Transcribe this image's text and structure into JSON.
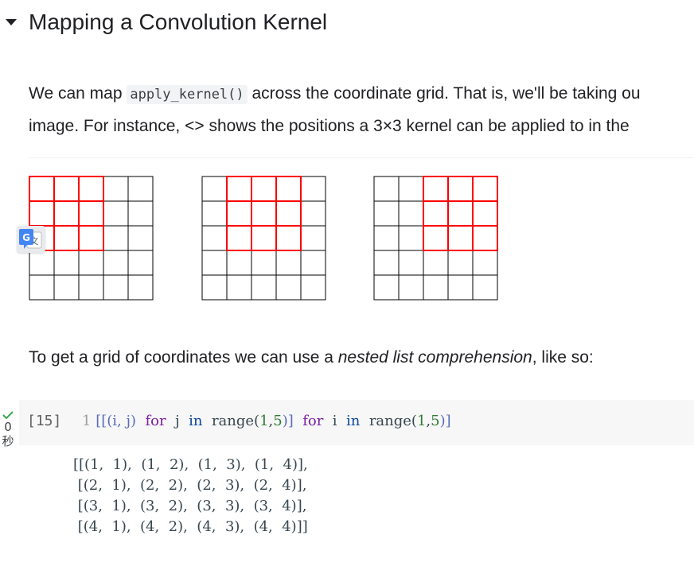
{
  "section": {
    "title": "Mapping a Convolution Kernel"
  },
  "intro": {
    "line1_before": "We can map ",
    "line1_code": "apply_kernel()",
    "line1_after": " across the coordinate grid. That is, we'll be taking ou",
    "line2": "image. For instance, <> shows the positions a 3×3 kernel can be applied to in the"
  },
  "figures": [
    {
      "grid_size": 5,
      "kernel_size": 3,
      "kernel_row": 0,
      "kernel_col": 0
    },
    {
      "grid_size": 5,
      "kernel_size": 3,
      "kernel_row": 0,
      "kernel_col": 1
    },
    {
      "grid_size": 5,
      "kernel_size": 3,
      "kernel_row": 0,
      "kernel_col": 2
    }
  ],
  "colors": {
    "grid_line": "#000000",
    "kernel_line": "#ff0000"
  },
  "paragraph2": {
    "before": "To get a grid of coordinates we can use a ",
    "emphasis": "nested list comprehension",
    "after": ", like so:"
  },
  "code_cell": {
    "execution_count": "[15]",
    "line_number": "1",
    "run_status_icon": "check-icon",
    "run_time_value": "0",
    "run_time_unit": "秒",
    "tokens": {
      "open": "[[(i, j)",
      "for1": "for",
      "var1": "j",
      "in1": "in",
      "range1": "range",
      "args1_open": "(",
      "args1_a": "1",
      "args1_sep": ",",
      "args1_b": "5",
      "args1_close": ")]",
      "for2": "for",
      "var2": "i",
      "in2": "in",
      "range2": "range",
      "args2_open": "(",
      "args2_a": "1",
      "args2_sep": ",",
      "args2_b": "5",
      "args2_close": ")]"
    }
  },
  "output": {
    "lines": [
      "[[(1,  1),  (1,  2),  (1,  3),  (1,  4)],",
      " [(2,  1),  (2,  2),  (2,  3),  (2,  4)],",
      " [(3,  1),  (3,  2),  (3,  3),  (3,  4)],",
      " [(4,  1),  (4,  2),  (4,  3),  (4,  4)]]"
    ]
  },
  "translate_badge": {
    "icon": "google-translate-icon"
  }
}
